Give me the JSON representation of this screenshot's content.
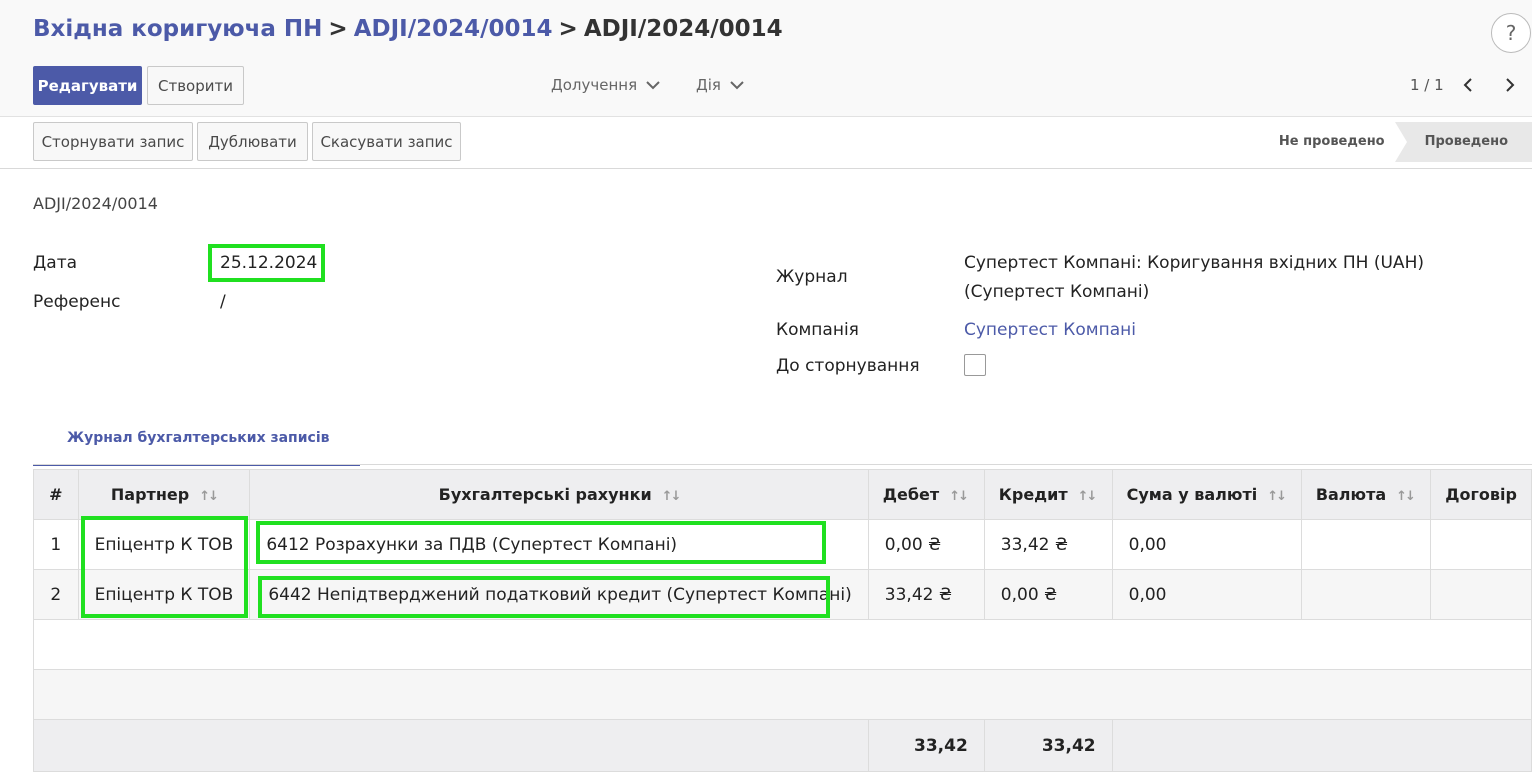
{
  "breadcrumb": {
    "level1": "Вхідна коригуюча ПН",
    "level2": "ADJI/2024/0014",
    "current": "ADJI/2024/0014",
    "separator": ">"
  },
  "toolbar": {
    "edit_label": "Редагувати",
    "create_label": "Створити",
    "attachments_label": "Долучення",
    "action_label": "Дія",
    "pager": "1 / 1",
    "help": "?"
  },
  "actions": {
    "reverse_label": "Сторнувати запис",
    "duplicate_label": "Дублювати",
    "cancel_label": "Скасувати запис"
  },
  "status": {
    "draft": "Не проведено",
    "posted": "Проведено"
  },
  "record": {
    "name": "ADJI/2024/0014",
    "date_label": "Дата",
    "date_value": "25.12.2024",
    "ref_label": "Референс",
    "ref_value": "/",
    "journal_label": "Журнал",
    "journal_value_line1": "Супертест Компані: Коригування вхідних ПН (UAH)",
    "journal_value_line2": "(Супертест Компані)",
    "company_label": "Компанія",
    "company_value": "Супертест Компані",
    "to_reverse_label": "До сторнування",
    "to_reverse_checked": false
  },
  "tab": {
    "label": "Журнал бухгалтерських записів"
  },
  "table": {
    "headers": [
      "#",
      "Партнер",
      "Бухгалтерські рахунки",
      "Дебет",
      "Кредит",
      "Сума у валюті",
      "Валюта",
      "Договір"
    ],
    "rows": [
      [
        "1",
        "Епіцентр К ТОВ",
        "6412 Розрахунки за ПДВ (Супертест Компані)",
        "0,00 ₴",
        "33,42 ₴",
        "0,00",
        ""
      ],
      [
        "2",
        "Епіцентр К ТОВ",
        "6442 Непідтверджений податковий кредит (Супертест Компані)",
        "33,42 ₴",
        "0,00 ₴",
        "0,00",
        ""
      ]
    ],
    "totals": {
      "debit": "33,42",
      "credit": "33,42"
    }
  },
  "colors": {
    "accent": "#4c5aa8",
    "highlight": "#20e020"
  },
  "icons": {
    "back": "back-arrow-icon",
    "sort": "sort-icon",
    "chevron": "chevron-down-icon"
  }
}
